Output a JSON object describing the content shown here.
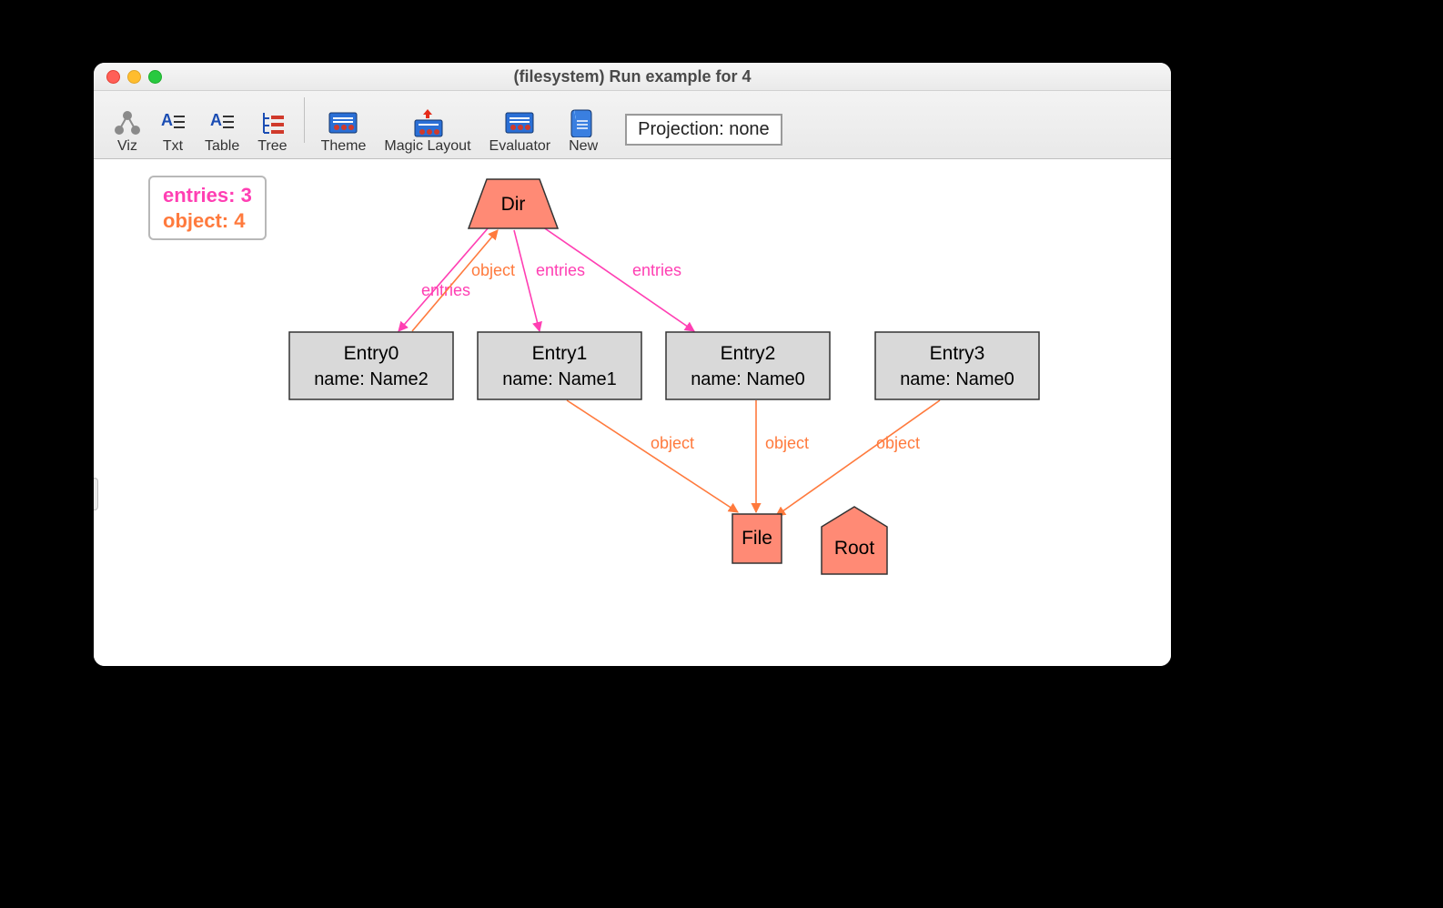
{
  "window": {
    "title": "(filesystem) Run example for 4"
  },
  "toolbar": {
    "buttons": [
      {
        "id": "viz",
        "label": "Viz"
      },
      {
        "id": "txt",
        "label": "Txt"
      },
      {
        "id": "table",
        "label": "Table"
      },
      {
        "id": "tree",
        "label": "Tree"
      },
      {
        "id": "theme",
        "label": "Theme"
      },
      {
        "id": "magic",
        "label": "Magic Layout"
      },
      {
        "id": "eval",
        "label": "Evaluator"
      },
      {
        "id": "new",
        "label": "New"
      }
    ],
    "projection": "Projection: none"
  },
  "legend": {
    "entries_label": "entries:",
    "entries_count": "3",
    "object_label": "object:",
    "object_count": "4"
  },
  "graph": {
    "nodes": {
      "dir": {
        "label_line1": "Dir"
      },
      "entry0": {
        "label_line1": "Entry0",
        "label_line2": "name: Name2"
      },
      "entry1": {
        "label_line1": "Entry1",
        "label_line2": "name: Name1"
      },
      "entry2": {
        "label_line1": "Entry2",
        "label_line2": "name: Name0"
      },
      "entry3": {
        "label_line1": "Entry3",
        "label_line2": "name: Name0"
      },
      "file": {
        "label_line1": "File"
      },
      "root": {
        "label_line1": "Root"
      }
    },
    "edges": {
      "dir_e0": {
        "label": "entries"
      },
      "dir_e1": {
        "label": "entries"
      },
      "dir_e2": {
        "label": "entries"
      },
      "e0_dir": {
        "label": "object"
      },
      "e1_file": {
        "label": "object"
      },
      "e2_file": {
        "label": "object"
      },
      "e3_file": {
        "label": "object"
      }
    }
  }
}
